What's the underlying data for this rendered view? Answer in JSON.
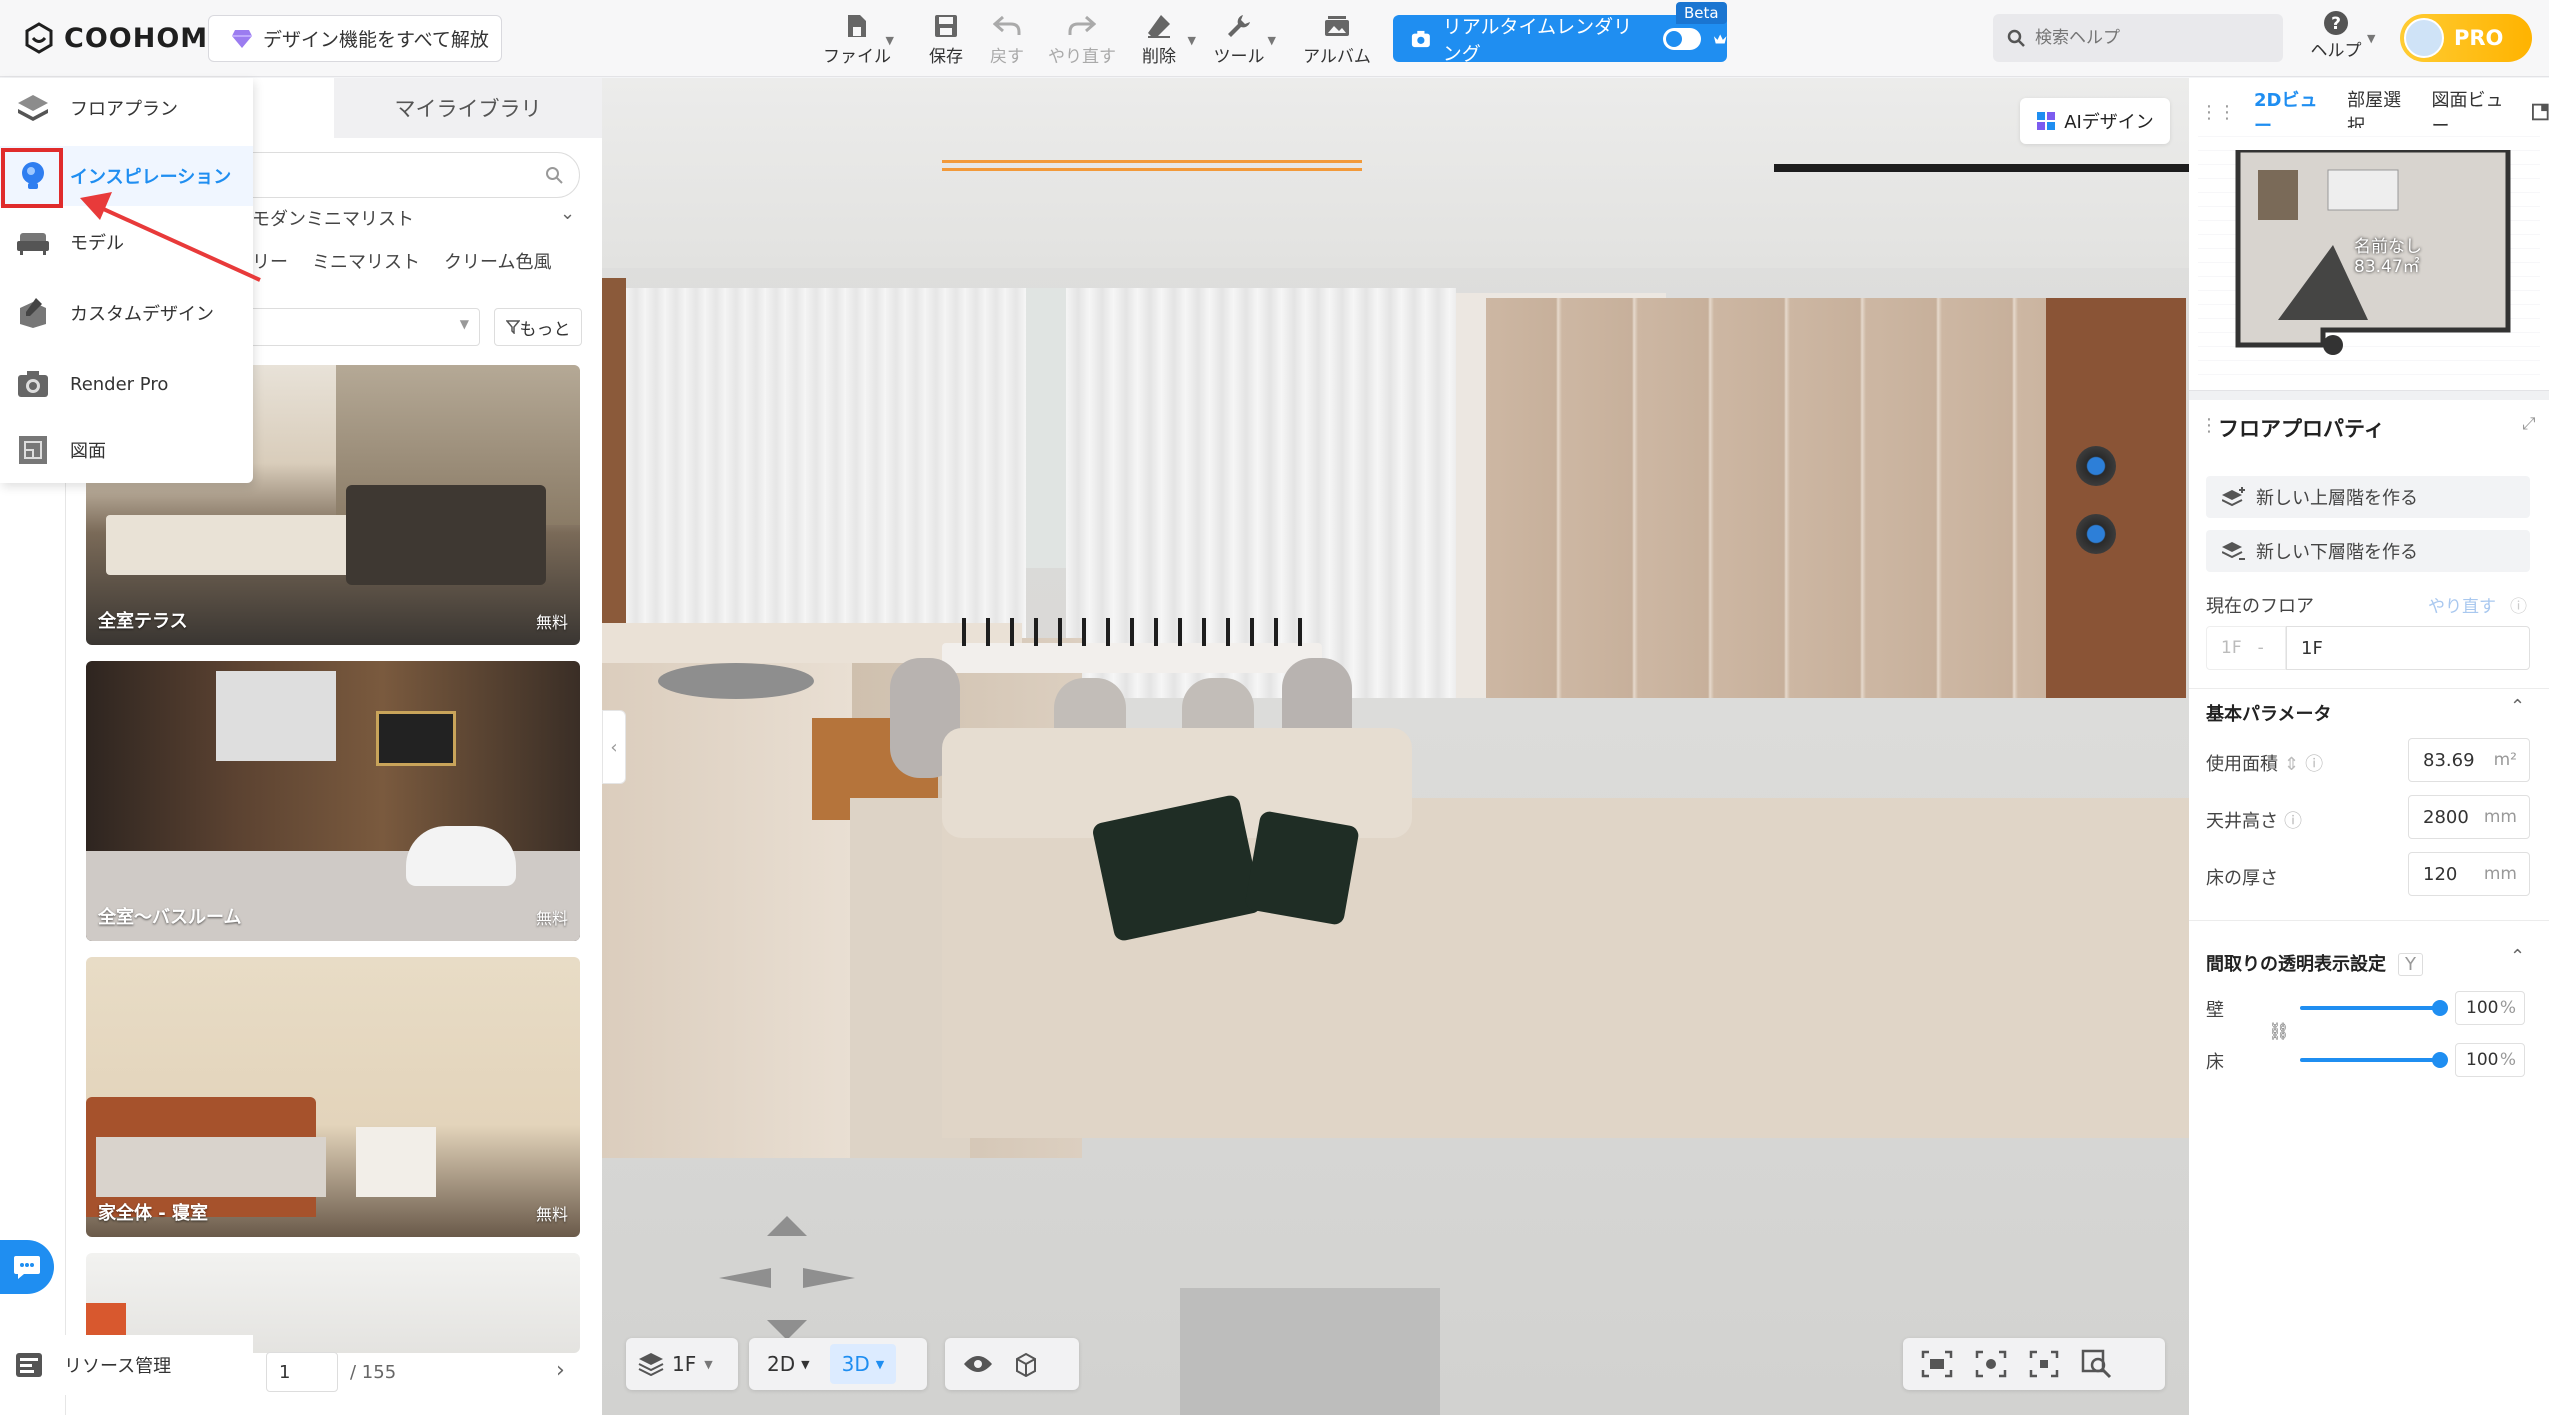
{
  "app": {
    "logo": "COOHOM"
  },
  "topbar": {
    "unlock_label": "デザイン機能をすべて解放",
    "tools": [
      {
        "label": "ファイル",
        "icon": "file-icon"
      },
      {
        "label": "保存",
        "icon": "save-icon"
      },
      {
        "label": "戻す",
        "icon": "undo-icon"
      },
      {
        "label": "やり直す",
        "icon": "redo-icon"
      },
      {
        "label": "削除",
        "icon": "eraser-icon"
      },
      {
        "label": "ツール",
        "icon": "wrench-icon"
      },
      {
        "label": "アルバム",
        "icon": "album-icon"
      }
    ],
    "realtime_label": "リアルタイムレンダリング",
    "beta": "Beta",
    "search_placeholder": "検索ヘルプ",
    "help_label": "ヘルプ",
    "pro_label": "PRO"
  },
  "leftnav": {
    "items": [
      "フロアプラン",
      "インスピレーション",
      "モデル",
      "カスタムデザイン",
      "Render Pro",
      "図面"
    ],
    "bottom": "リソース管理"
  },
  "library": {
    "tabs": [
      "",
      "マイライブラリ"
    ],
    "style": "モダンミニマリスト",
    "chips": [
      "リー",
      "ミニマリスト",
      "クリーム色風"
    ],
    "more": "もっと",
    "cards": [
      {
        "label": "全室テラス",
        "tag": "無料"
      },
      {
        "label": "全室〜バスルーム",
        "tag": "無料"
      },
      {
        "label": "家全体 - 寝室",
        "tag": "無料"
      },
      {
        "label": "",
        "tag": ""
      }
    ],
    "page": "1",
    "page_total": "/ 155"
  },
  "viewport": {
    "ai_label": "AIデザイン",
    "floor": "1F",
    "view2d": "2D",
    "view3d": "3D"
  },
  "rightpanel": {
    "tabs": [
      "2Dビュー",
      "部屋選択",
      "図面ビュー"
    ],
    "room_name": "名前なし",
    "room_area": "83.47㎡",
    "title": "フロアプロパティ",
    "new_upper": "新しい上層階を作る",
    "new_lower": "新しい下層階を作る",
    "current_floor": "現在のフロア",
    "redo": "やり直す",
    "floor_prefix": "1F",
    "floor_name": "1F",
    "basic_params": "基本パラメータ",
    "area_label": "使用面積",
    "area_value": "83.69",
    "area_unit": "m²",
    "ceiling_label": "天井高さ",
    "ceiling_value": "2800",
    "ceiling_unit": "mm",
    "floor_thick_label": "床の厚さ",
    "floor_thick_value": "120",
    "floor_thick_unit": "mm",
    "transparency_label": "間取りの透明表示設定",
    "transparency_key": "Y",
    "wall_label": "壁",
    "wall_value": "100",
    "floor_label": "床",
    "floor_value": "100",
    "percent": "%"
  }
}
